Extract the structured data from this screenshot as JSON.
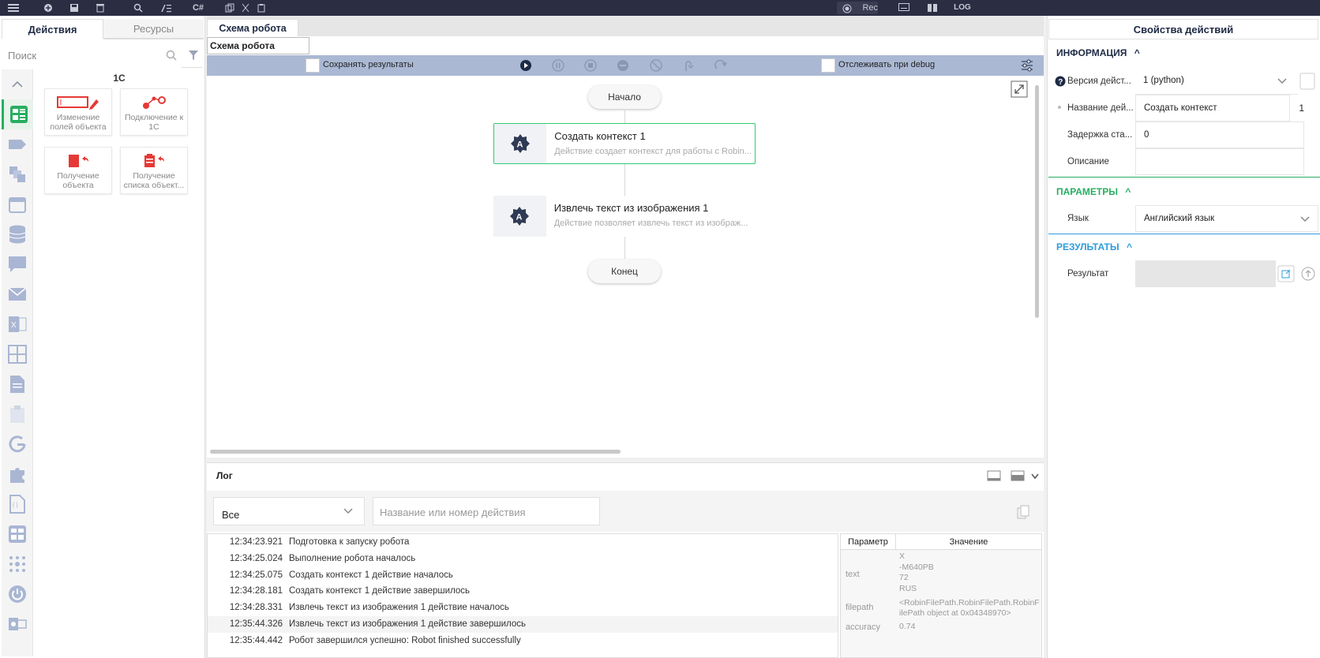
{
  "topbar": {
    "rec_label": "Rec",
    "log_label": "LOG",
    "csharp_label": "C#"
  },
  "left": {
    "tabs": [
      {
        "label": "Действия"
      },
      {
        "label": "Ресурсы"
      }
    ],
    "search_placeholder": "Поиск",
    "category_title": "1С",
    "cards": [
      {
        "label": "Изменение полей объекта"
      },
      {
        "label": "Подключение к 1С"
      },
      {
        "label": "Получение объекта"
      },
      {
        "label": "Получение списка объект..."
      }
    ]
  },
  "center": {
    "tab_label": "Схема робота",
    "subtab_label": "Схема робота",
    "save_results_label": "Сохранять результаты",
    "track_debug_label": "Отслеживать при debug",
    "start_node": "Начало",
    "end_node": "Конец",
    "nodes": [
      {
        "title": "Создать контекст  1",
        "desc": "Действие создает контекст для работы с Robin..."
      },
      {
        "title": "Извлечь текст из изображения  1",
        "desc": "Действие позволяет извлечь текст из изображ..."
      }
    ]
  },
  "log": {
    "title": "Лог",
    "filter_value": "Все",
    "search_placeholder": "Название или номер действия",
    "rows": [
      {
        "time": "12:34:23.921",
        "msg": "Подготовка к запуску робота"
      },
      {
        "time": "12:34:25.024",
        "msg": "Выполнение робота началось"
      },
      {
        "time": "12:34:25.075",
        "msg": "Создать контекст 1 действие началось"
      },
      {
        "time": "12:34:28.181",
        "msg": "Создать контекст 1 действие завершилось"
      },
      {
        "time": "12:34:28.331",
        "msg": "Извлечь текст из изображения 1 действие началось"
      },
      {
        "time": "12:35:44.326",
        "msg": "Извлечь текст из изображения 1 действие завершилось"
      },
      {
        "time": "12:35:44.442",
        "msg": "Робот завершился успешно: Robot finished successfully"
      }
    ],
    "params_header": {
      "param": "Параметр",
      "value": "Значение"
    },
    "params": [
      {
        "name": "text",
        "value": "X\n-M640PB\n72\nRUS"
      },
      {
        "name": "filepath",
        "value": "<RobinFilePath.RobinFilePath.RobinFilePath object at 0x04348970>"
      },
      {
        "name": "accuracy",
        "value": "0.74"
      }
    ]
  },
  "right": {
    "title": "Свойства действий",
    "info_section": "ИНФОРМАЦИЯ",
    "version_label": "Версия дейст...",
    "version_value": "1 (python)",
    "name_label": "Название дей...",
    "name_value": "Создать контекст",
    "name_index": "1",
    "delay_label": "Задержка ста...",
    "delay_value": "0",
    "desc_label": "Описание",
    "desc_value": "",
    "params_section": "ПАРАМЕТРЫ",
    "lang_label": "Язык",
    "lang_value": "Английский язык",
    "results_section": "РЕЗУЛЬТАТЫ",
    "result_label": "Результат"
  }
}
